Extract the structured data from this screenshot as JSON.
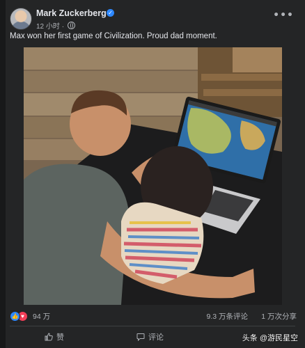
{
  "post": {
    "author": "Mark Zuckerberg",
    "time": "12 小时",
    "separator": "·",
    "text": "Max won her first game of Civilization. Proud dad moment.",
    "more_label": "•••"
  },
  "icons": {
    "verified": "verified-badge-icon",
    "privacy": "globe-icon",
    "like_reaction": "like-reaction-icon",
    "love_reaction": "love-reaction-icon",
    "like_action": "thumbs-up-icon",
    "comment_action": "comment-bubble-icon"
  },
  "stats": {
    "reactions": "94 万",
    "comments": "9.3 万条评论",
    "shares": "1 万次分享"
  },
  "actions": {
    "like": "赞",
    "comment": "评论"
  },
  "watermark": "头条 @游民星空",
  "colors": {
    "background": "#242526",
    "text": "#e4e6eb",
    "secondary": "#b0b3b8",
    "brand_blue": "#2d88ff",
    "love_red": "#f33e58"
  }
}
